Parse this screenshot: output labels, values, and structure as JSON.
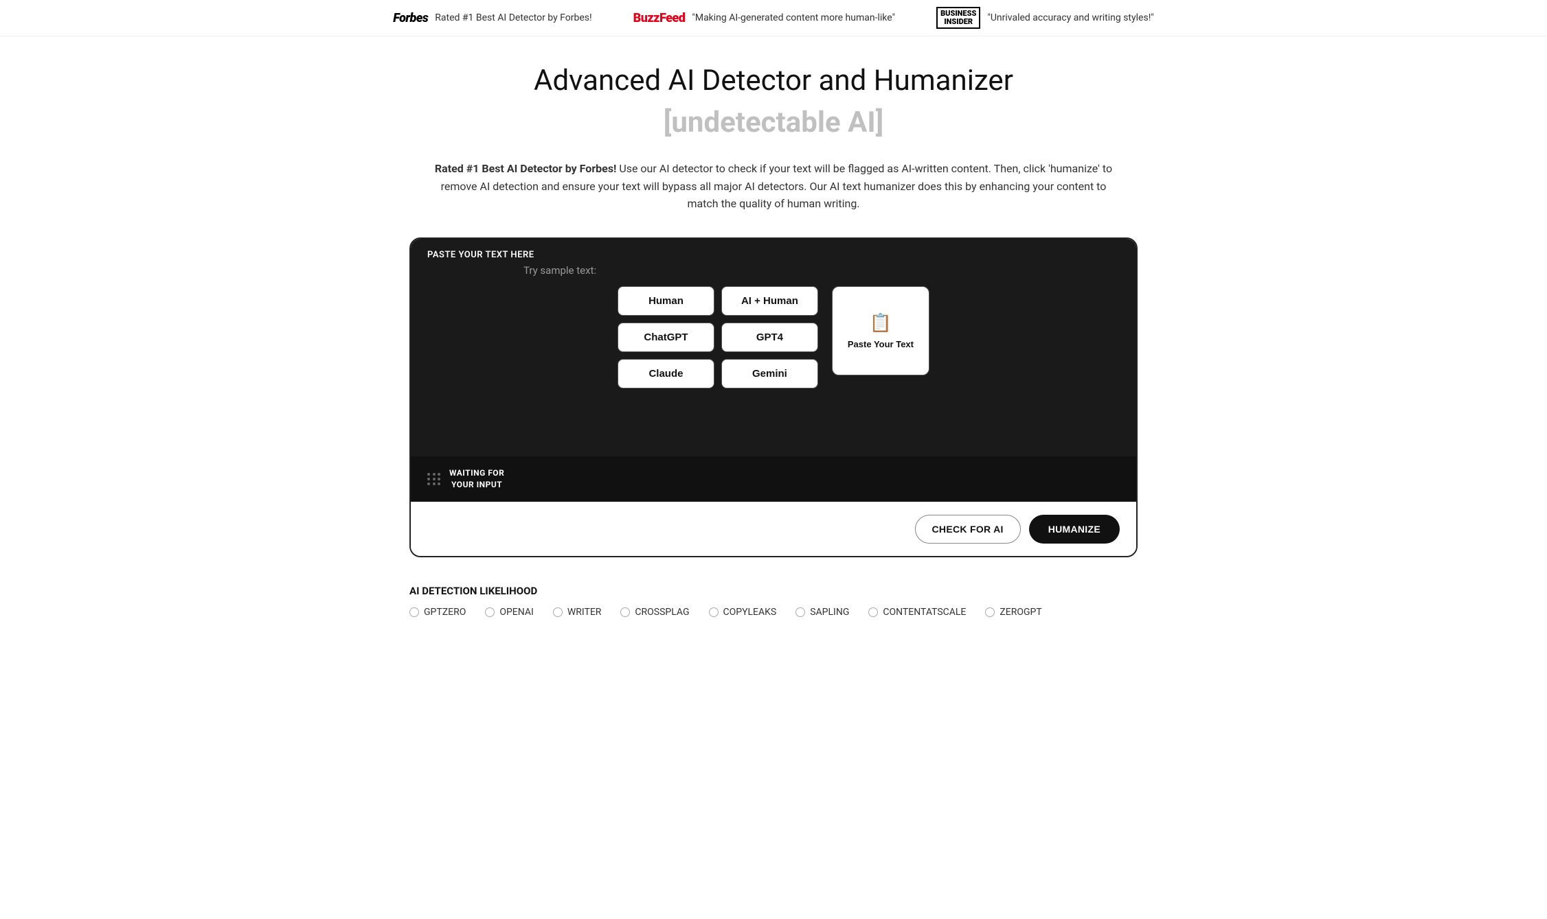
{
  "topbar": {
    "items": [
      {
        "logo": "Forbes",
        "text": "Rated #1 Best AI Detector by Forbes!"
      },
      {
        "logo": "BuzzFeed",
        "text": "\"Making AI-generated content more human-like\""
      },
      {
        "logo": "Business Insider",
        "text": "\"Unrivaled accuracy and writing styles!\""
      }
    ]
  },
  "header": {
    "main_title": "Advanced AI Detector and Humanizer",
    "subtitle": "[undetectable AI]",
    "description_bold": "Rated #1 Best AI Detector by Forbes!",
    "description_rest": " Use our AI detector to check if your text will be flagged as AI-written content. Then, click 'humanize' to remove AI detection and ensure your text will bypass all major AI detectors. Our AI text humanizer does this by enhancing your content to match the quality of human writing."
  },
  "toolbox": {
    "paste_label": "PASTE YOUR TEXT HERE",
    "sample_text_label": "Try sample text:",
    "sample_buttons": [
      {
        "label": "Human"
      },
      {
        "label": "AI + Human"
      },
      {
        "label": "ChatGPT"
      },
      {
        "label": "GPT4"
      },
      {
        "label": "Claude"
      },
      {
        "label": "Gemini"
      }
    ],
    "paste_your_text_btn": "Paste Your Text",
    "clipboard_icon": "📋",
    "status_line1": "WAITING FOR",
    "status_line2": "YOUR INPUT",
    "check_ai_label": "CHECK FOR AI",
    "humanize_label": "HUMANIZE"
  },
  "detection": {
    "title": "AI DETECTION LIKELIHOOD",
    "detectors": [
      "GPTZERO",
      "OPENAI",
      "WRITER",
      "CROSSPLAG",
      "COPYLEAKS",
      "SAPLING",
      "CONTENTATSCALE",
      "ZEROGPT"
    ]
  }
}
